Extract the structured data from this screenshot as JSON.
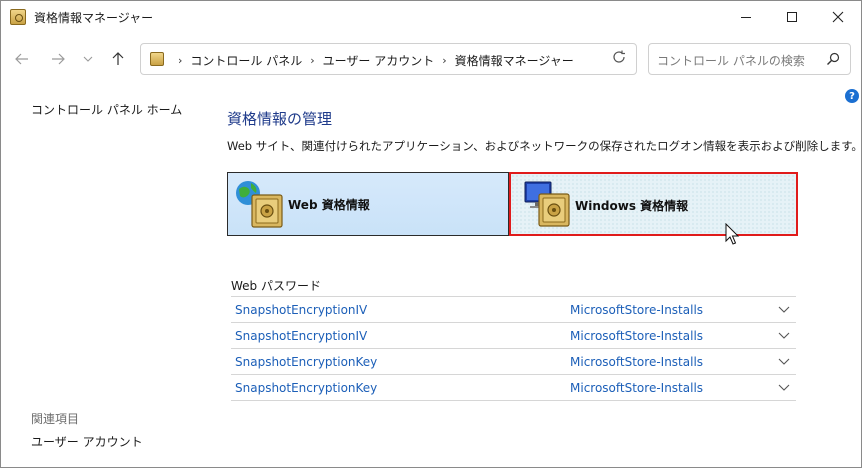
{
  "window": {
    "title": "資格情報マネージャー"
  },
  "nav": {
    "breadcrumbs": [
      "コントロール パネル",
      "ユーザー アカウント",
      "資格情報マネージャー"
    ],
    "search_placeholder": "コントロール パネルの検索"
  },
  "left": {
    "home_link": "コントロール パネル ホーム",
    "related_title": "関連項目",
    "related_link": "ユーザー アカウント"
  },
  "main": {
    "title": "資格情報の管理",
    "description": "Web サイト、関連付けられたアプリケーション、およびネットワークの保存されたログオン情報を表示および削除します。",
    "web_credentials_label": "Web 資格情報",
    "windows_credentials_label": "Windows 資格情報",
    "selected_tab": "Windows 資格情報",
    "web_passwords_header": "Web パスワード",
    "passwords": [
      {
        "name": "SnapshotEncryptionIV",
        "store": "MicrosoftStore-Installs"
      },
      {
        "name": "SnapshotEncryptionIV",
        "store": "MicrosoftStore-Installs"
      },
      {
        "name": "SnapshotEncryptionKey",
        "store": "MicrosoftStore-Installs"
      },
      {
        "name": "SnapshotEncryptionKey",
        "store": "MicrosoftStore-Installs"
      }
    ]
  },
  "colors": {
    "accent_title": "#1e3a8a",
    "link": "#1c5fb8",
    "selection_border": "#e01b1b",
    "web_tile": "#cfe5f9"
  },
  "icons": [
    "credential-manager-icon",
    "back-arrow-icon",
    "forward-arrow-icon",
    "recent-locations-icon",
    "up-arrow-icon",
    "refresh-icon",
    "search-icon",
    "help-icon",
    "globe-vault-icon",
    "monitor-vault-icon",
    "chevron-down-icon",
    "mouse-cursor-icon"
  ]
}
